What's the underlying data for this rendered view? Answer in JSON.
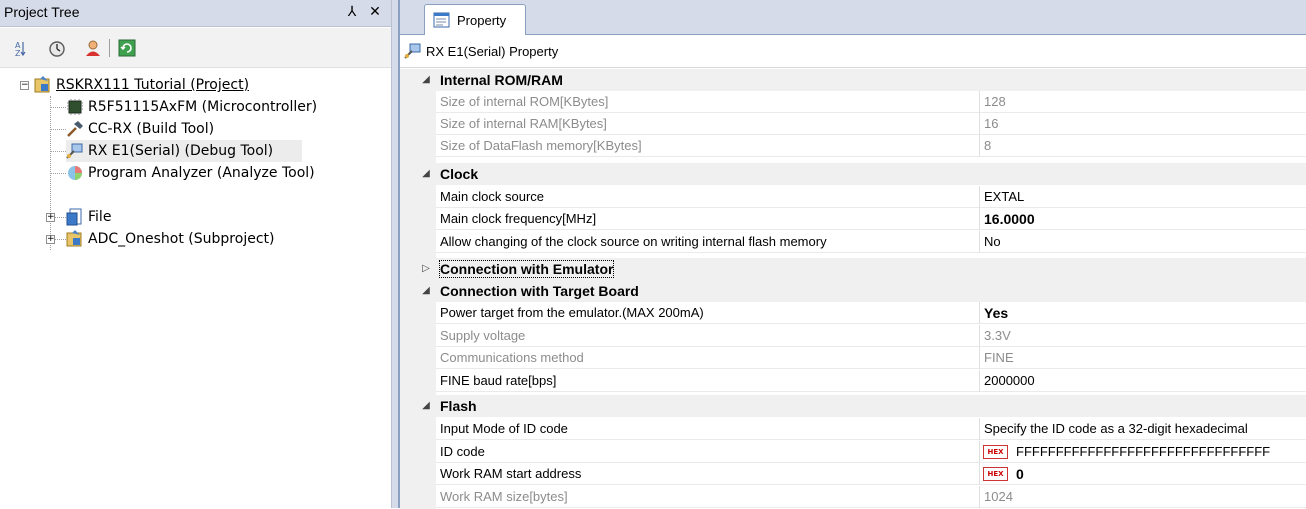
{
  "left_pane": {
    "title": "Project Tree",
    "pin_glyph": "⅄",
    "close_glyph": "✕",
    "toolbar_icons": [
      "sort-icon",
      "timer-icon",
      "user-icon",
      "refresh-icon"
    ],
    "tree": [
      {
        "label": "RSKRX111 Tutorial (Project)",
        "icon": "project-icon",
        "level": 0,
        "expander": "−",
        "underline": true
      },
      {
        "label": "R5F51115AxFM (Microcontroller)",
        "icon": "chip-icon",
        "level": 1
      },
      {
        "label": "CC-RX (Build Tool)",
        "icon": "hammer-icon",
        "level": 1
      },
      {
        "label": "RX E1(Serial) (Debug Tool)",
        "icon": "debugger-icon",
        "level": 1,
        "selected": true
      },
      {
        "label": "Program Analyzer (Analyze Tool)",
        "icon": "analyzer-icon",
        "level": 1
      },
      {
        "label": "File",
        "icon": "file-folder-icon",
        "level": 1,
        "expander": "+"
      },
      {
        "label": "ADC_Oneshot (Subproject)",
        "icon": "subproject-icon",
        "level": 1,
        "expander": "+"
      }
    ]
  },
  "right_pane": {
    "tab_label": "Property",
    "header_label": "RX E1(Serial) Property",
    "categories": [
      {
        "label": "Internal ROM/RAM",
        "expanded": true,
        "rows": [
          {
            "name": "Size of internal ROM[KBytes]",
            "value": "128",
            "grey": true
          },
          {
            "name": "Size of internal RAM[KBytes]",
            "value": "16",
            "grey": true
          },
          {
            "name": "Size of DataFlash memory[KBytes]",
            "value": "8",
            "grey": true
          }
        ]
      },
      {
        "label": "Clock",
        "expanded": true,
        "rows": [
          {
            "name": "Main clock source",
            "value": "EXTAL"
          },
          {
            "name": "Main clock frequency[MHz]",
            "value": "16.0000",
            "bold": true
          },
          {
            "name": "Allow changing of the clock source on writing internal flash memory",
            "value": "No"
          }
        ]
      },
      {
        "label": "Connection with Emulator",
        "expanded": false,
        "focused": true,
        "rows": []
      },
      {
        "label": "Connection with Target Board",
        "expanded": true,
        "rows": [
          {
            "name": "Power target from the emulator.(MAX 200mA)",
            "value": "Yes",
            "bold": true
          },
          {
            "name": "Supply voltage",
            "value": "3.3V",
            "grey": true
          },
          {
            "name": "Communications method",
            "value": "FINE",
            "grey": true
          },
          {
            "name": "FINE baud rate[bps]",
            "value": "2000000"
          }
        ]
      },
      {
        "label": "Flash",
        "expanded": true,
        "rows": [
          {
            "name": "Input Mode of ID code",
            "value": "Specify the ID code as a 32-digit hexadecimal"
          },
          {
            "name": "ID code",
            "value": "FFFFFFFFFFFFFFFFFFFFFFFFFFFFFFFF",
            "hex": true
          },
          {
            "name": "Work RAM start address",
            "value": "0",
            "hex": true,
            "bold": true
          },
          {
            "name": "Work RAM size[bytes]",
            "value": "1024",
            "grey": true
          }
        ]
      }
    ],
    "hex_badge_text": "HEX",
    "expanded_glyph": "◢",
    "collapsed_glyph": "▷"
  },
  "colors": {
    "panel_header": "#d6dbe9",
    "category_bg": "#f0f0f0",
    "grey_text": "#8c8c8c",
    "hex_badge": "#cc0000"
  }
}
